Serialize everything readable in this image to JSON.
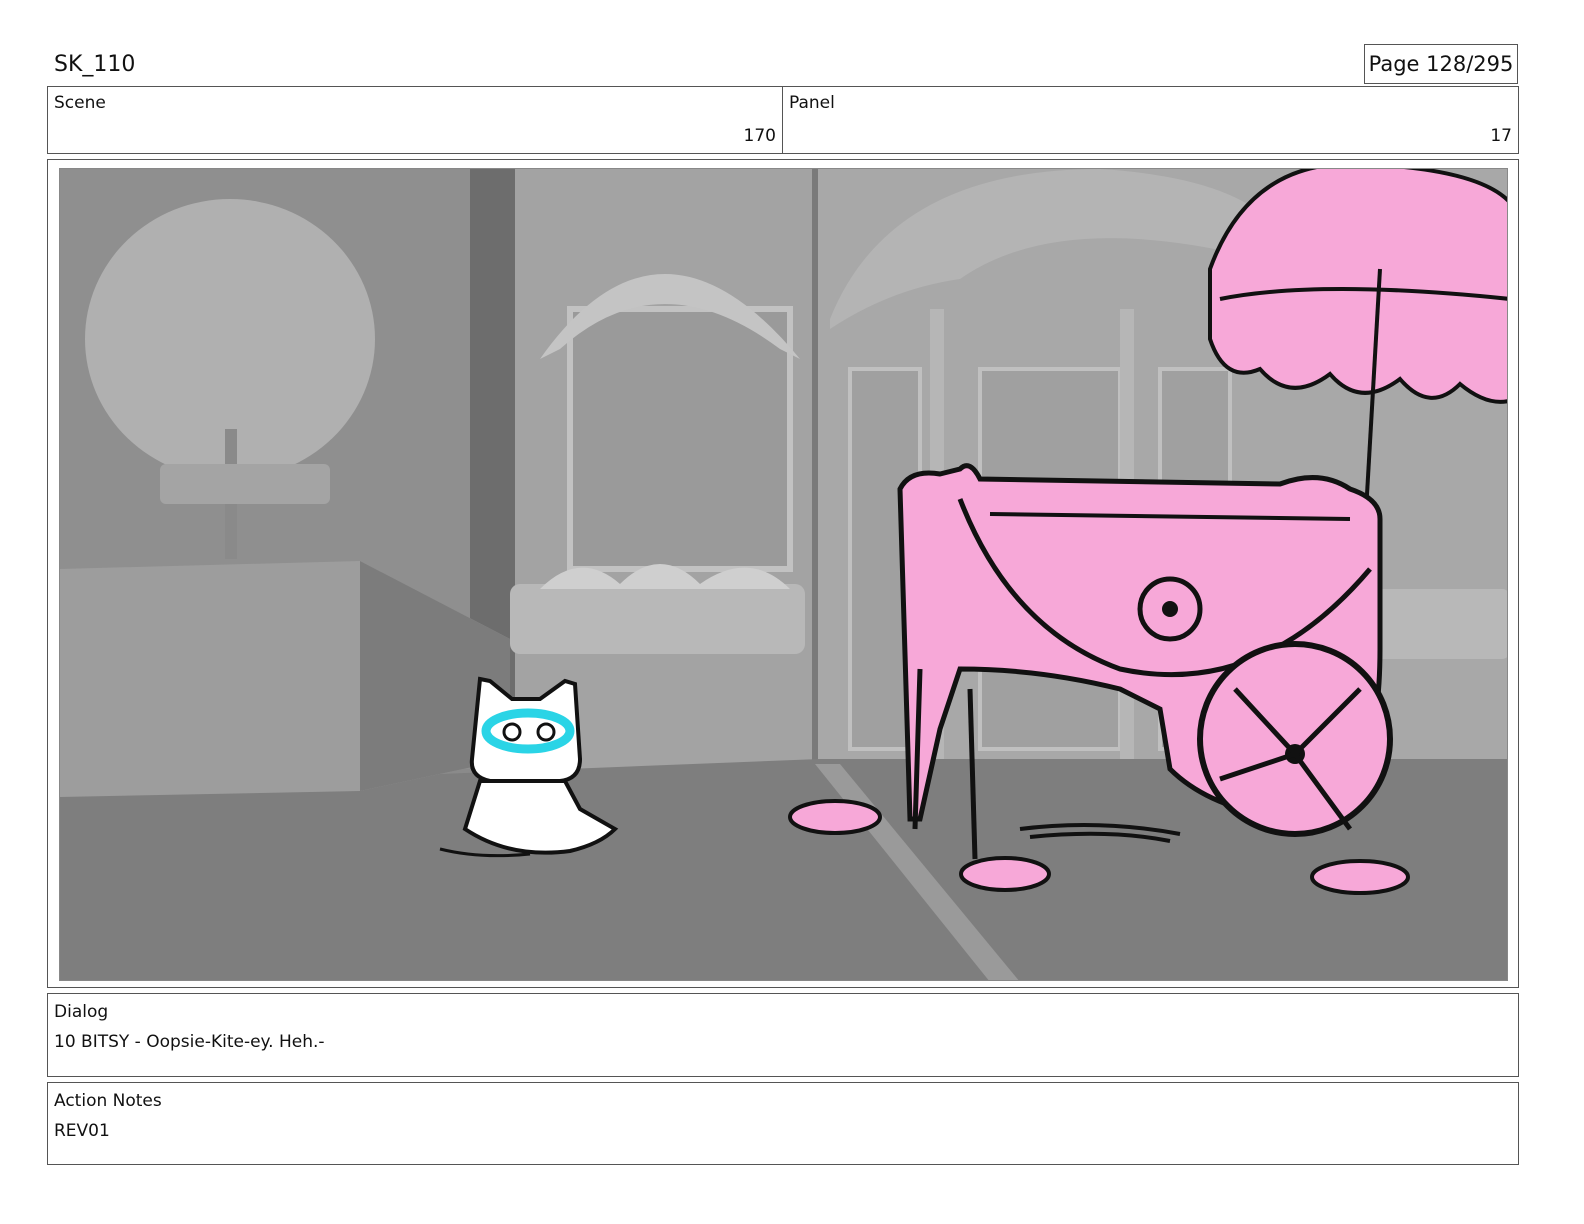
{
  "header": {
    "sheet_id": "SK_110",
    "page": "Page 128/295"
  },
  "scene": {
    "label": "Scene",
    "value": "170"
  },
  "panel": {
    "label": "Panel",
    "value": "17"
  },
  "dialog": {
    "label": "Dialog",
    "text": "10 BITSY - Oopsie-Kite-ey. Heh.-"
  },
  "action_notes": {
    "label": "Action Notes",
    "text": "REV01"
  }
}
